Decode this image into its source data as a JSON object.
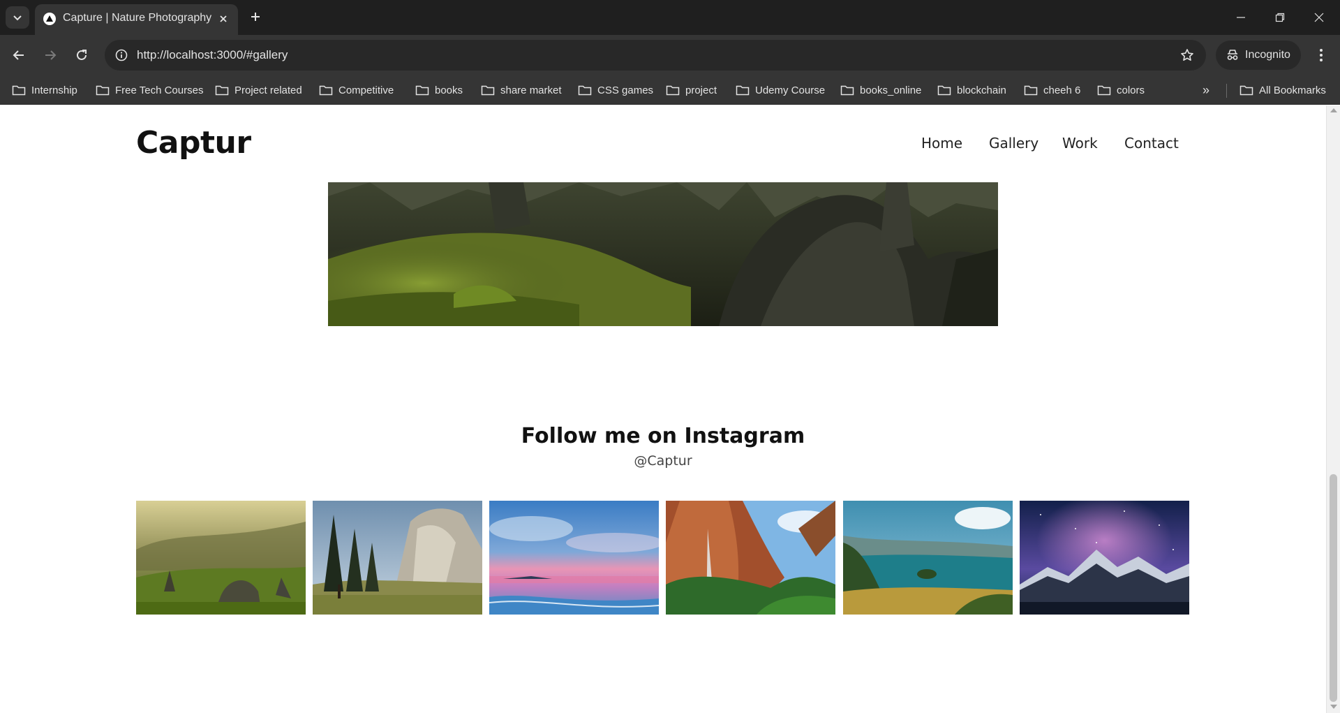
{
  "browser": {
    "tab_title": "Capture | Nature Photography",
    "url": "http://localhost:3000/#gallery",
    "incognito_label": "Incognito",
    "bookmarks": [
      "Internship",
      "Free Tech Courses",
      "Project related",
      "Competitive",
      "books",
      "share market",
      "CSS games",
      "project",
      "Udemy Course",
      "books_online",
      "blockchain",
      "cheeh 6",
      "colors"
    ],
    "overflow_label": "»",
    "all_bookmarks_label": "All Bookmarks"
  },
  "site": {
    "logo": "Captur",
    "nav": [
      "Home",
      "Gallery",
      "Work",
      "Contact"
    ]
  },
  "instagram": {
    "title": "Follow me on Instagram",
    "handle": "@Captur",
    "photos": [
      "mountain-valley-sunrise",
      "el-capitan-forest",
      "ocean-sunset-beach",
      "red-canyon-waterfall",
      "blue-lake-island",
      "milky-way-mountains"
    ]
  },
  "colors": {
    "chrome_dark": "#1f1f1f",
    "chrome_mid": "#353535",
    "page_bg": "#ffffff",
    "text_dark": "#111111"
  }
}
